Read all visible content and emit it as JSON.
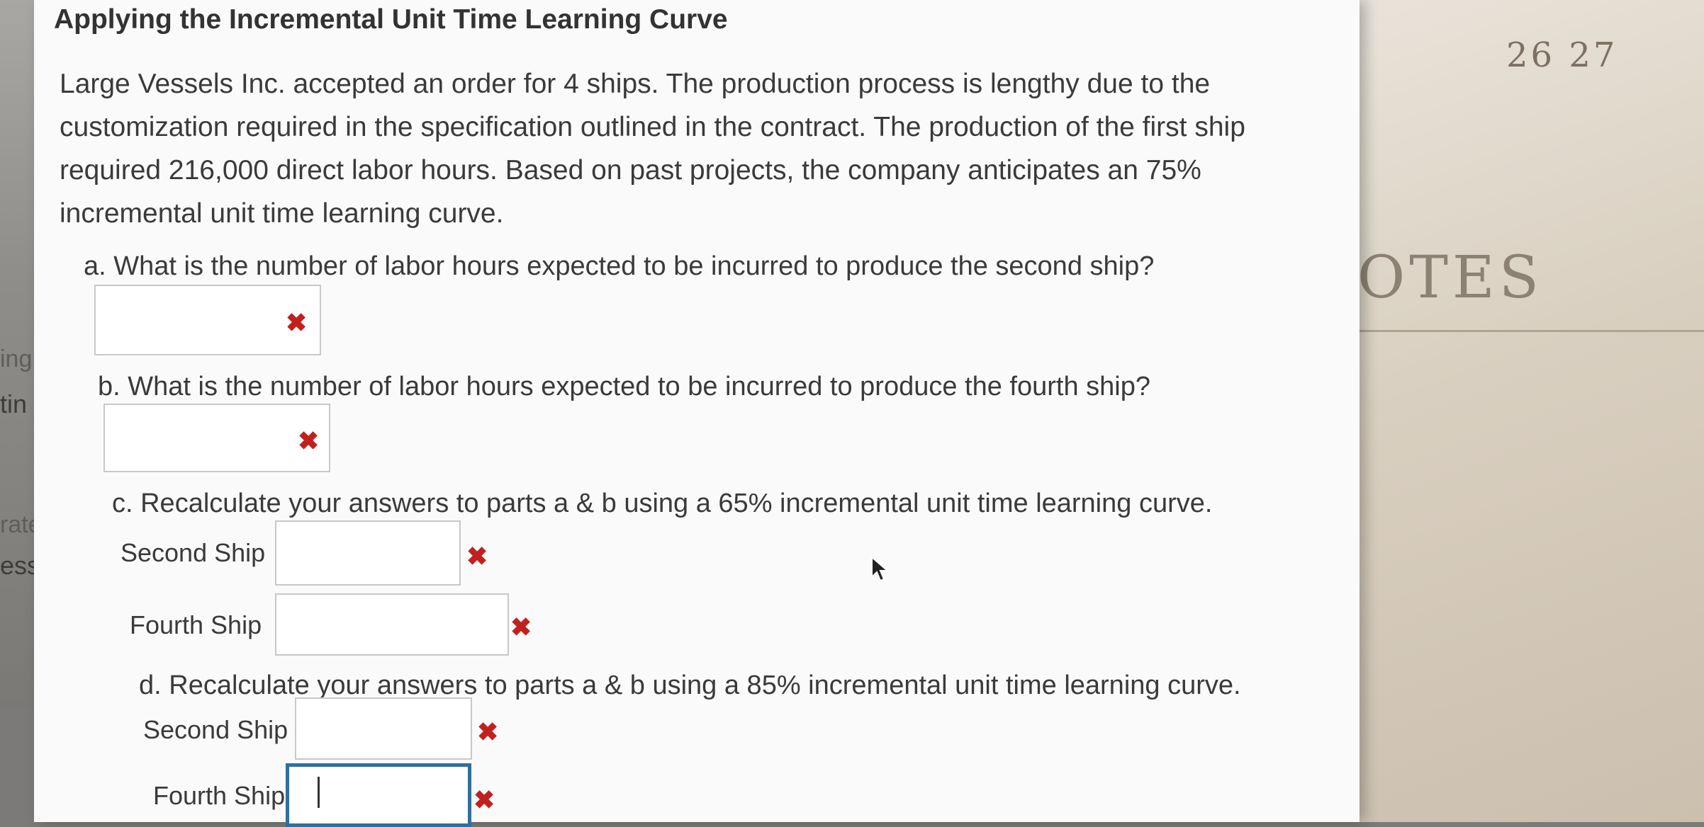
{
  "left_window": {
    "fragments": [
      "ing",
      "tin",
      "rategy",
      "ess C"
    ]
  },
  "textbook": {
    "page_numbers": "26  27",
    "heading": "OTES"
  },
  "question": {
    "title": "Applying the Incremental Unit Time Learning Curve",
    "paragraph": "Large Vessels Inc. accepted an order for 4 ships. The production process is lengthy due to the customization required in the specification outlined in the contract. The production of the first ship required 216,000 direct labor hours. Based on past projects, the company anticipates an 75% incremental unit time learning curve.",
    "part_a": "a. What is the number of labor hours expected to be incurred to produce the second ship?",
    "part_b": "b. What is the number of labor hours expected to be incurred to produce the fourth ship?",
    "part_c": "c. Recalculate your answers to parts a & b using a 65% incremental unit time learning curve.",
    "part_d": "d. Recalculate your answers to parts a & b using a 85% incremental unit time learning curve.",
    "second_ship_label": "Second Ship",
    "fourth_ship_label": "Fourth Ship"
  },
  "answers": {
    "a": "",
    "b": "",
    "c_second": "",
    "c_fourth": "",
    "d_second": "",
    "d_fourth": ""
  },
  "status": {
    "incorrect_mark": "✖",
    "incorrect_color": "#c0211f"
  }
}
